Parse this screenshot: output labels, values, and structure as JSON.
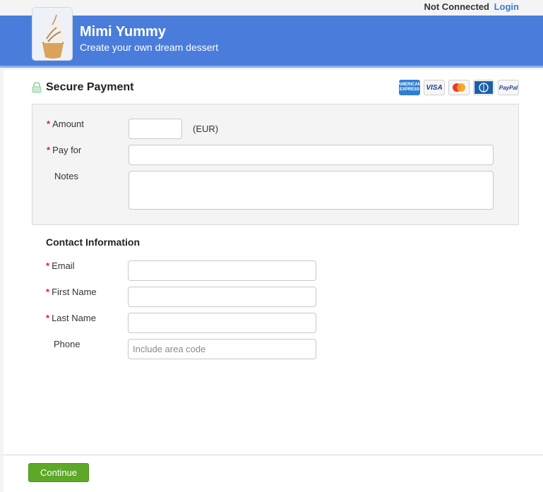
{
  "header": {
    "status_text": "Not Connected",
    "login_label": "Login",
    "title": "Mimi Yummy",
    "subtitle": "Create your own dream dessert",
    "logo_icon": "cupcake-meringue-icon"
  },
  "payment": {
    "title": "Secure Payment",
    "lock_icon": "lock-icon",
    "cards": [
      {
        "name": "amex",
        "label": "AMERICAN EXPRESS"
      },
      {
        "name": "visa",
        "label": "VISA"
      },
      {
        "name": "mastercard",
        "label": ""
      },
      {
        "name": "diners",
        "label": "Diners Club"
      },
      {
        "name": "paypal",
        "label": "PayPal"
      }
    ],
    "required_mark": "*",
    "amount_label": "Amount",
    "amount_value": "",
    "currency_label": "(EUR)",
    "pay_for_label": "Pay for",
    "pay_for_value": "",
    "notes_label": "Notes",
    "notes_value": ""
  },
  "contact": {
    "title": "Contact Information",
    "email_label": "Email",
    "first_name_label": "First Name",
    "last_name_label": "Last Name",
    "phone_label": "Phone",
    "phone_placeholder": "Include area code"
  },
  "footer": {
    "continue_label": "Continue"
  },
  "colors": {
    "banner": "#4a7ddb",
    "link": "#3a7bd5",
    "required": "#d9232d",
    "continue_button": "#5da827"
  }
}
